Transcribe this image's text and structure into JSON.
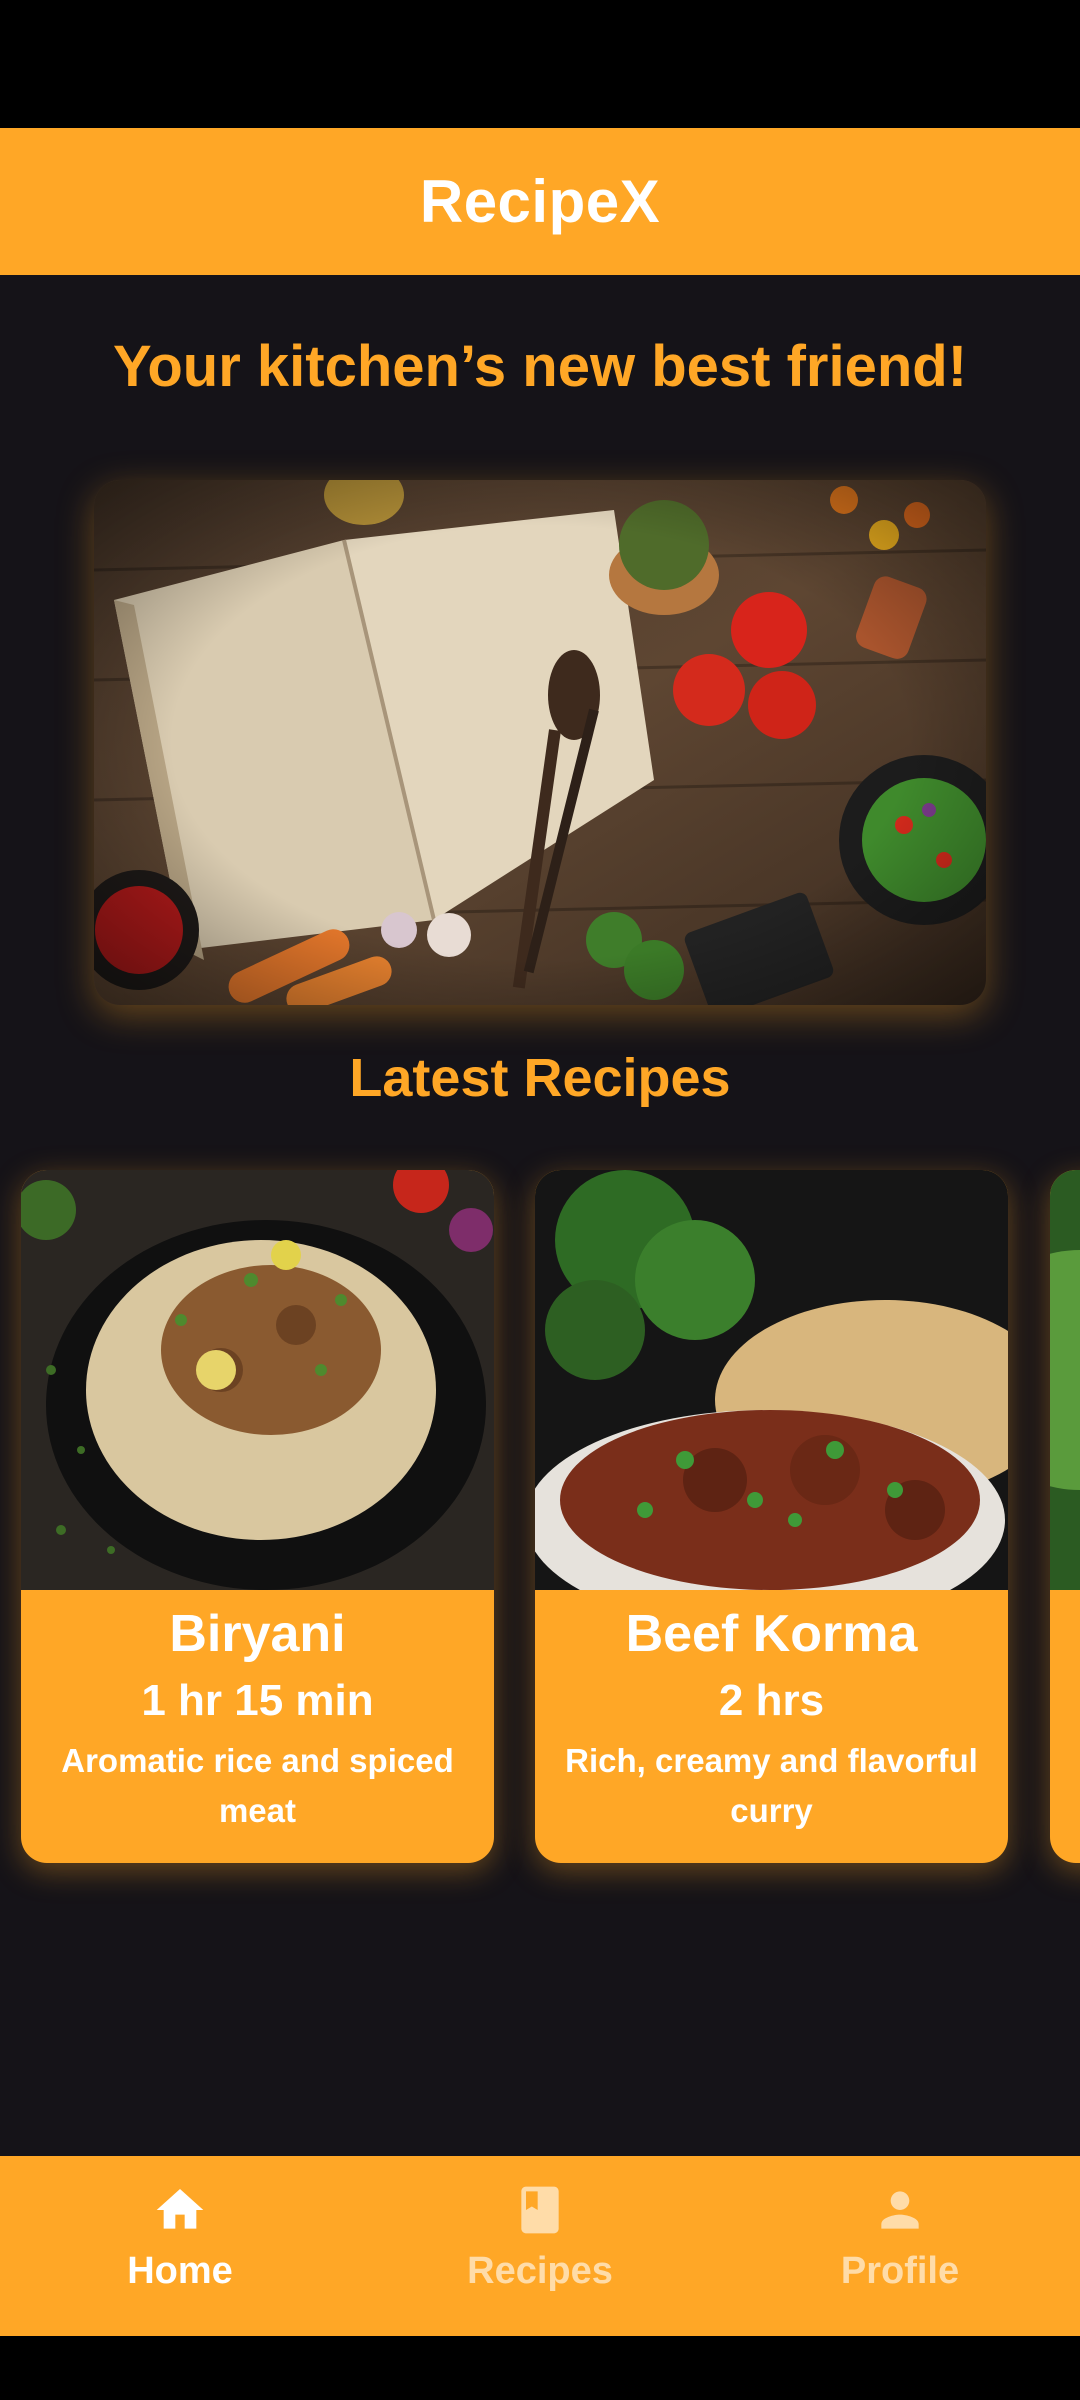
{
  "app": {
    "title": "RecipeX",
    "accent_color": "#FFA726",
    "background_color": "#151318"
  },
  "home": {
    "tagline": "Your kitchen’s new best friend!",
    "hero_image": "open recipe book with vegetables and spices",
    "section_title": "Latest Recipes"
  },
  "recipes": [
    {
      "title": "Biryani",
      "time": "1 hr 15 min",
      "description": "Aromatic rice and spiced meat",
      "image": "biryani plate"
    },
    {
      "title": "Beef Korma",
      "time": "2 hrs",
      "description": "Rich, creamy and flavorful curry",
      "image": "beef korma with naan"
    }
  ],
  "nav": {
    "items": [
      {
        "label": "Home",
        "icon": "home-icon",
        "active": true
      },
      {
        "label": "Recipes",
        "icon": "book-icon",
        "active": false
      },
      {
        "label": "Profile",
        "icon": "person-icon",
        "active": false
      }
    ]
  }
}
